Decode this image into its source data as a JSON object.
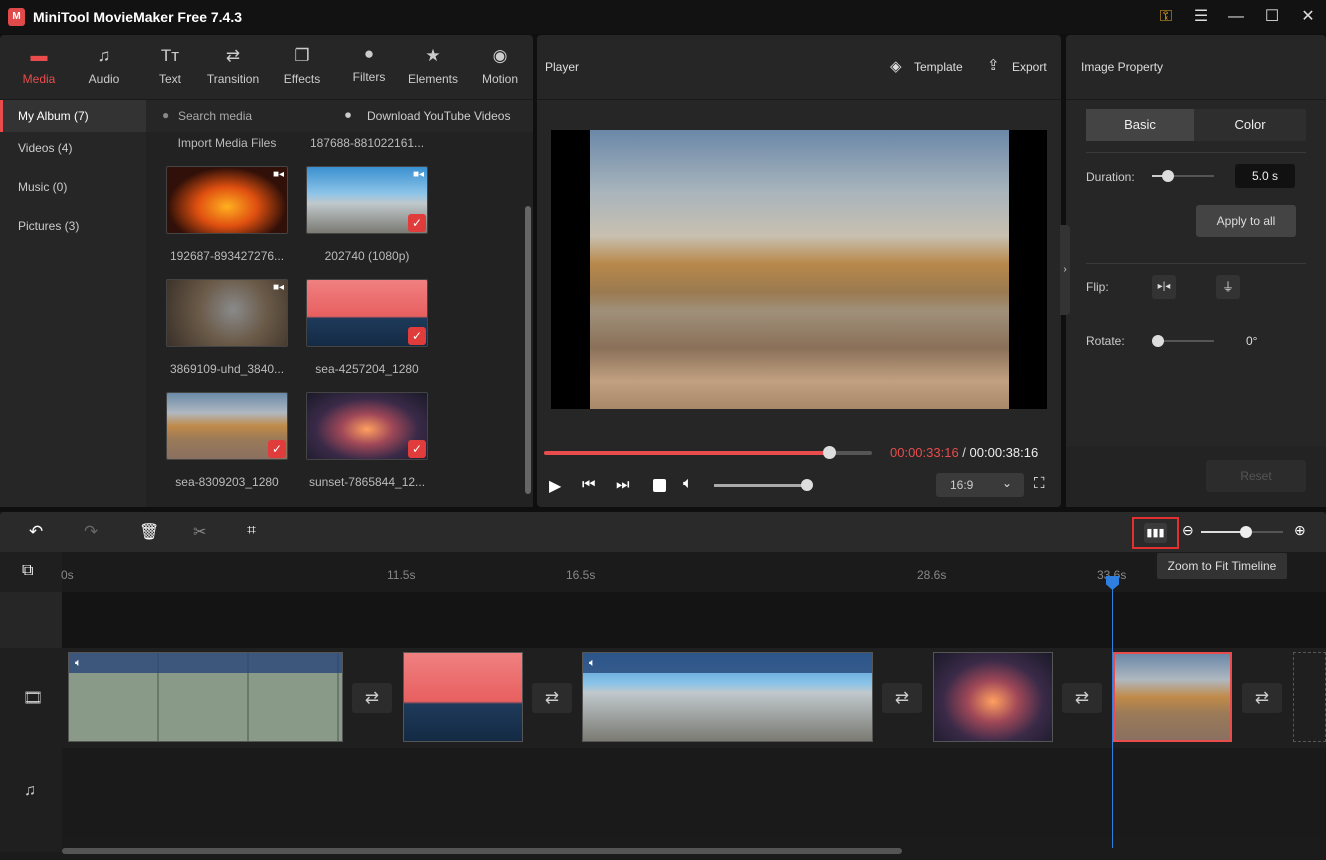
{
  "app": {
    "title": "MiniTool MovieMaker Free 7.4.3",
    "logo_text": "M"
  },
  "window": {
    "key_icon": "key-icon",
    "menu_icon": "menu-icon",
    "minimize_icon": "minimize-icon",
    "maximize_icon": "maximize-icon",
    "close_icon": "close-icon"
  },
  "tabs": [
    {
      "label": "Media",
      "active": true
    },
    {
      "label": "Audio"
    },
    {
      "label": "Text"
    },
    {
      "label": "Transition"
    },
    {
      "label": "Effects"
    },
    {
      "label": "Filters"
    },
    {
      "label": "Elements"
    },
    {
      "label": "Motion"
    }
  ],
  "sidebar": {
    "items": [
      {
        "label": "My Album (7)",
        "selected": true
      },
      {
        "label": "Videos (4)"
      },
      {
        "label": "Music (0)"
      },
      {
        "label": "Pictures (3)"
      }
    ]
  },
  "media": {
    "search_placeholder": "Search media",
    "download_label": "Download YouTube Videos",
    "top_labels": [
      "Import Media Files",
      "187688-881022161..."
    ],
    "items": [
      {
        "name": "192687-893427276...",
        "type": "video",
        "added": false
      },
      {
        "name": "202740 (1080p)",
        "type": "video",
        "added": true
      },
      {
        "name": "3869109-uhd_3840...",
        "type": "video",
        "added": false
      },
      {
        "name": "sea-4257204_1280",
        "type": "image",
        "added": true
      },
      {
        "name": "sea-8309203_1280",
        "type": "image",
        "added": true
      },
      {
        "name": "sunset-7865844_12...",
        "type": "image",
        "added": true
      }
    ]
  },
  "player": {
    "title": "Player",
    "template_label": "Template",
    "export_label": "Export",
    "current_time": "00:00:33:16",
    "separator": " / ",
    "total_time": "00:00:38:16",
    "progress_percent": 87,
    "volume_percent": 100,
    "aspect_ratio": "16:9",
    "accent": "#e84c4c"
  },
  "property": {
    "title": "Image Property",
    "tabs": [
      "Basic",
      "Color"
    ],
    "duration_label": "Duration:",
    "duration_value": "5.0 s",
    "apply_all": "Apply to all",
    "flip_label": "Flip:",
    "rotate_label": "Rotate:",
    "rotate_value": "0°",
    "reset": "Reset"
  },
  "timeline": {
    "tooltip": "Zoom to Fit Timeline",
    "ruler": [
      "0s",
      "11.5s",
      "16.5s",
      "28.6s",
      "33.6s"
    ],
    "playhead_time": "33.6s",
    "zoom_percent": 55,
    "highlight_color": "#e03030",
    "playhead_color": "#2f7fe0"
  }
}
